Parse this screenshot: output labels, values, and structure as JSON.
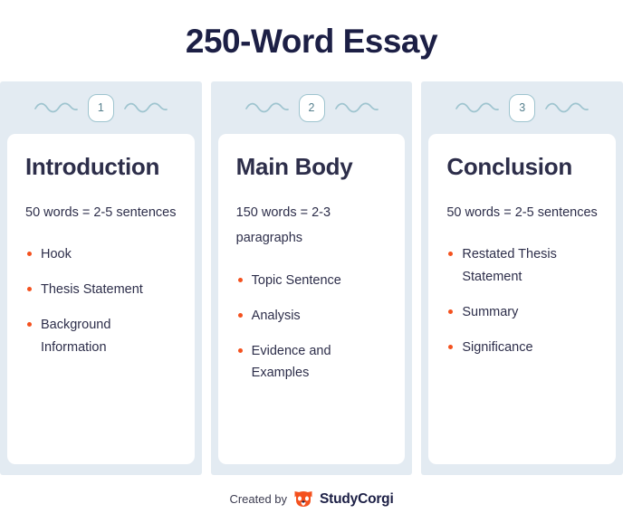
{
  "header": {
    "title": "250-Word Essay"
  },
  "colors": {
    "band_background": "#e3ebf2",
    "card_background": "#ffffff",
    "heading_navy": "#2d2e4a",
    "title_navy": "#1c1f45",
    "bullet_orange": "#f4511e",
    "badge_teal": "#9ec4cf",
    "wave_teal": "#9ec4cf",
    "logo_orange": "#f4511e"
  },
  "columns": [
    {
      "step": "1",
      "decoration": "wave-squiggle-icon",
      "title": "Introduction",
      "meta": "50 words = 2-5 sentences",
      "bullets": [
        "Hook",
        "Thesis Statement",
        "Background Information"
      ]
    },
    {
      "step": "2",
      "decoration": "wave-squiggle-icon",
      "title": "Main Body",
      "meta": "150 words = 2-3 paragraphs",
      "bullets": [
        "Topic Sentence",
        "Analysis",
        "Evidence and Examples"
      ]
    },
    {
      "step": "3",
      "decoration": "wave-squiggle-icon",
      "title": "Conclusion",
      "meta": "50 words = 2-5 sentences",
      "bullets": [
        "Restated Thesis Statement",
        "Summary",
        "Significance"
      ]
    }
  ],
  "footer": {
    "credit": "Created by",
    "brand": "StudyCorgi",
    "logo_icon": "corgi-face-icon"
  }
}
